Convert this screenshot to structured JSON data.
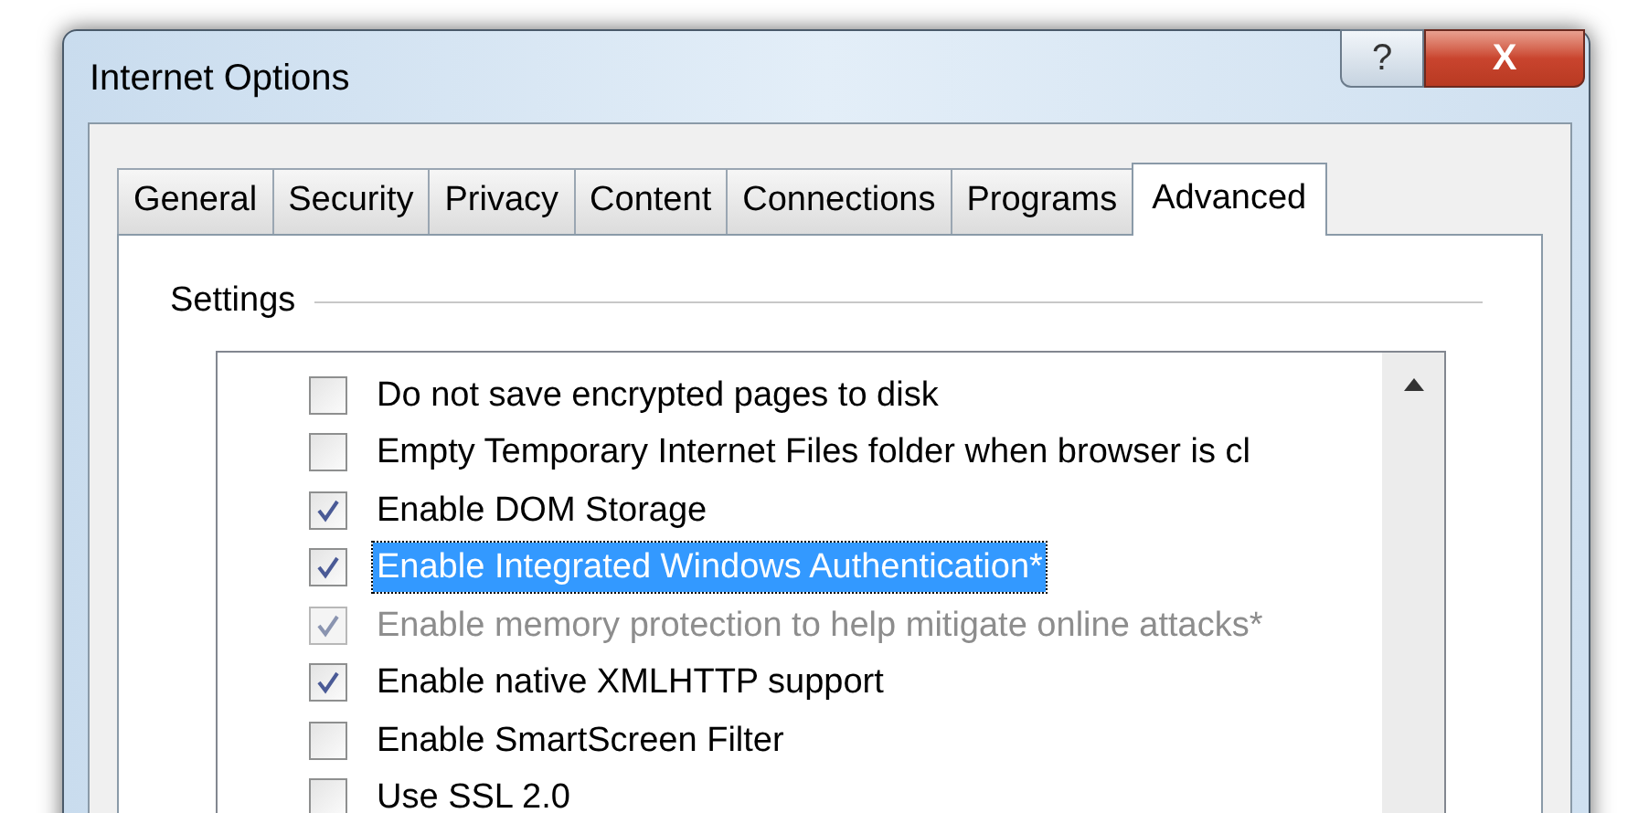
{
  "window": {
    "title": "Internet Options",
    "help_button": "?",
    "close_button": "X"
  },
  "tabs": [
    {
      "label": "General",
      "selected": false
    },
    {
      "label": "Security",
      "selected": false
    },
    {
      "label": "Privacy",
      "selected": false
    },
    {
      "label": "Content",
      "selected": false
    },
    {
      "label": "Connections",
      "selected": false
    },
    {
      "label": "Programs",
      "selected": false
    },
    {
      "label": "Advanced",
      "selected": true
    }
  ],
  "settings": {
    "title": "Settings",
    "items": [
      {
        "label": "Do not save encrypted pages to disk",
        "checked": false,
        "disabled": false,
        "selected": false
      },
      {
        "label": "Empty Temporary Internet Files folder when browser is cl",
        "checked": false,
        "disabled": false,
        "selected": false
      },
      {
        "label": "Enable DOM Storage",
        "checked": true,
        "disabled": false,
        "selected": false
      },
      {
        "label": "Enable Integrated Windows Authentication*",
        "checked": true,
        "disabled": false,
        "selected": true
      },
      {
        "label": "Enable memory protection to help mitigate online attacks*",
        "checked": true,
        "disabled": true,
        "selected": false
      },
      {
        "label": "Enable native XMLHTTP support",
        "checked": true,
        "disabled": false,
        "selected": false
      },
      {
        "label": "Enable SmartScreen Filter",
        "checked": false,
        "disabled": false,
        "selected": false
      },
      {
        "label": "Use SSL 2.0",
        "checked": false,
        "disabled": false,
        "selected": false
      }
    ]
  }
}
